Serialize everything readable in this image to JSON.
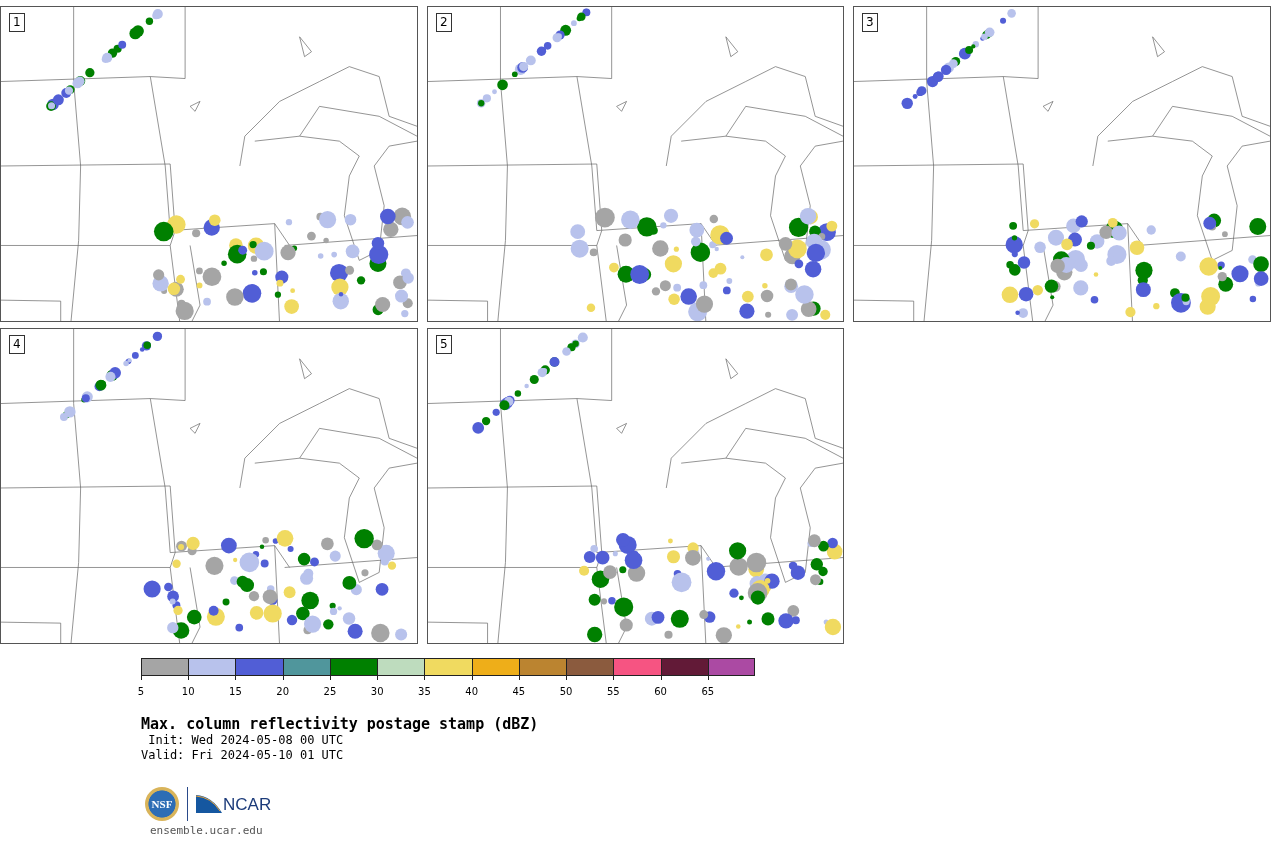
{
  "panels": [
    {
      "label": "1"
    },
    {
      "label": "2"
    },
    {
      "label": "3"
    },
    {
      "label": "4"
    },
    {
      "label": "5"
    }
  ],
  "colorbar": {
    "bins": [
      {
        "color": "#a5a5a5",
        "tick": "5"
      },
      {
        "color": "#b8c2ec",
        "tick": "10"
      },
      {
        "color": "#515ed6",
        "tick": "15"
      },
      {
        "color": "#50969c",
        "tick": "20"
      },
      {
        "color": "#008000",
        "tick": "25"
      },
      {
        "color": "#bedcbe",
        "tick": "30"
      },
      {
        "color": "#f0da60",
        "tick": "35"
      },
      {
        "color": "#eeae19",
        "tick": "40"
      },
      {
        "color": "#bb8430",
        "tick": "45"
      },
      {
        "color": "#8b5b3e",
        "tick": "50"
      },
      {
        "color": "#f65482",
        "tick": "55"
      },
      {
        "color": "#621a37",
        "tick": "60"
      },
      {
        "color": "#ab4aa3",
        "tick": "65"
      }
    ]
  },
  "title": "Max. column reflectivity postage stamp (dBZ)",
  "init": " Init: Wed 2024-05-08 00 UTC",
  "valid": "Valid: Fri 2024-05-10 01 UTC",
  "logo": {
    "nsf": "NSF",
    "ncar": "NCAR"
  },
  "url": "ensemble.ucar.edu"
}
